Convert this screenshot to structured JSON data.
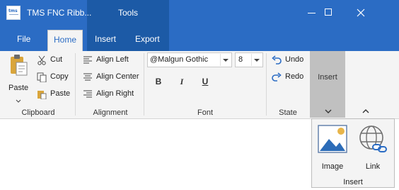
{
  "window": {
    "title": "TMS FNC Ribb...",
    "context_tab": "Tools"
  },
  "tabs": [
    {
      "label": "File"
    },
    {
      "label": "Home",
      "active": true
    },
    {
      "label": "Insert"
    },
    {
      "label": "Export"
    }
  ],
  "groups": {
    "clipboard": {
      "label": "Clipboard",
      "paste": "Paste",
      "cut": "Cut",
      "copy": "Copy",
      "paste_small": "Paste"
    },
    "alignment": {
      "label": "Alignment",
      "left": "Align Left",
      "center": "Align Center",
      "right": "Align Right"
    },
    "font": {
      "label": "Font",
      "family": "@Malgun Gothic",
      "size": "8",
      "bold": "B",
      "italic": "I",
      "underline": "U"
    },
    "state": {
      "label": "State",
      "undo": "Undo",
      "redo": "Redo"
    },
    "insert": {
      "label": "Insert",
      "image": "Image",
      "link": "Link",
      "popup_label": "Insert"
    }
  },
  "colors": {
    "titlebar": "#2b6cc4",
    "context_tab": "#1c5aa6",
    "ribbon": "#f4f4f4",
    "accent": "#2b6cc4"
  }
}
